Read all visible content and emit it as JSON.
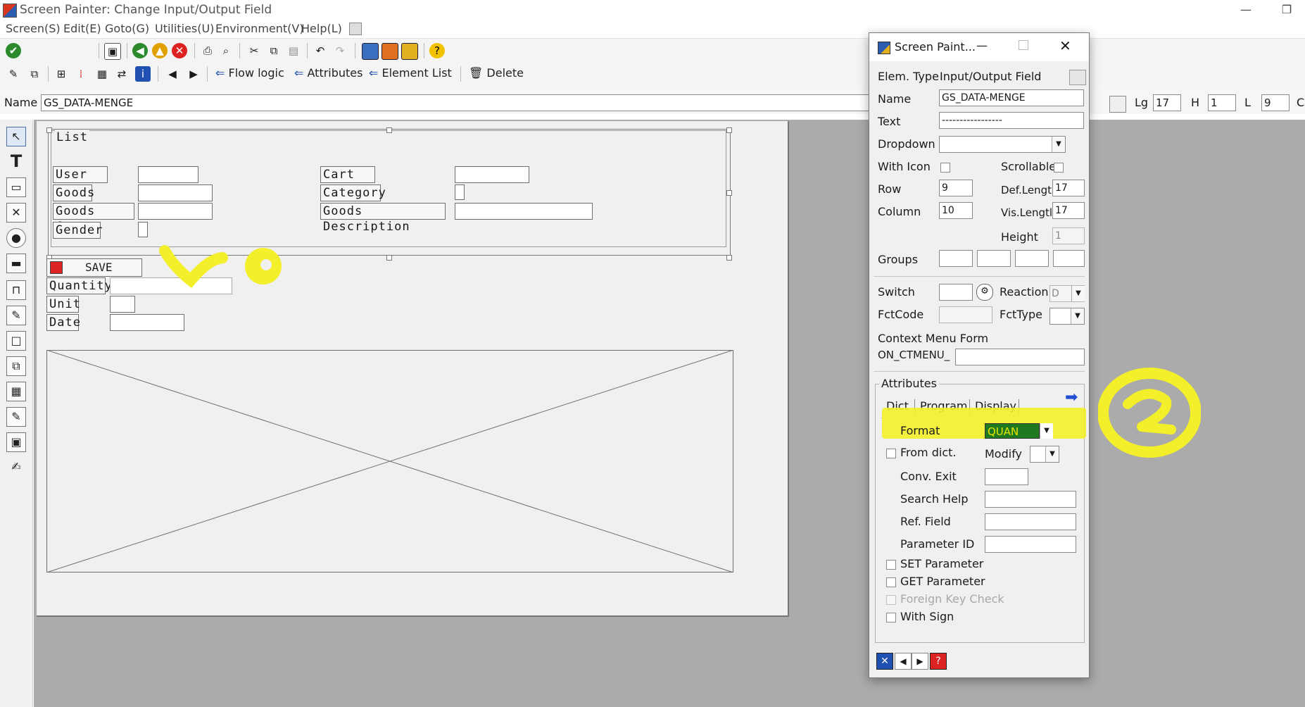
{
  "window": {
    "title": "Screen Painter:  Change Input/Output Field",
    "minimize": "—",
    "restore": "❐"
  },
  "menu": [
    "Screen(S)",
    "Edit(E)",
    "Goto(G)",
    "Utilities(U)",
    "Environment(V)",
    "Help(L)"
  ],
  "toolbar2": {
    "flow_logic": "Flow logic",
    "attributes": "Attributes",
    "element_list": "Element List",
    "delete": "Delete"
  },
  "namerow": {
    "label": "Name",
    "value": "GS_DATA-MENGE",
    "lg_label": "Lg",
    "lg_value": "17",
    "h_label": "H",
    "h_value": "1",
    "l_label": "L",
    "l_value": "9",
    "c_label": "C"
  },
  "screen": {
    "frame_title": "List",
    "labels_left": [
      "User ID",
      "Goods",
      "Goods Count",
      "Gender"
    ],
    "labels_right": [
      "Cart NO",
      "Category",
      "Goods Description"
    ],
    "save_button": "SAVE",
    "labels_bottom": [
      "Quantity",
      "Unit",
      "Date"
    ]
  },
  "popup": {
    "title": "Screen Paint...",
    "elem_type_label": "Elem. Type",
    "elem_type_value": "Input/Output Field",
    "name_label": "Name",
    "name_value": "GS_DATA-MENGE",
    "text_label": "Text",
    "text_value": "-----------------",
    "dropdown_label": "Dropdown",
    "with_icon_label": "With Icon",
    "scrollable_label": "Scrollable",
    "row_label": "Row",
    "row_value": "9",
    "column_label": "Column",
    "column_value": "10",
    "def_length_label": "Def.Lengtl",
    "def_length_value": "17",
    "vis_length_label": "Vis.Lengtl",
    "vis_length_value": "17",
    "height_label": "Height",
    "height_value": "1",
    "groups_label": "Groups",
    "switch_label": "Switch",
    "reaction_label": "Reaction",
    "reaction_value": "D",
    "fctcode_label": "FctCode",
    "fcttype_label": "FctType",
    "context_menu_label": "Context Menu Form",
    "context_menu_prefix": "ON_CTMENU_",
    "attributes_group": "Attributes",
    "tabs": [
      "Dict",
      "Program",
      "Display"
    ],
    "format_label": "Format",
    "format_value": "QUAN",
    "from_dict_label": "From dict.",
    "modify_label": "Modify",
    "conv_exit_label": "Conv. Exit",
    "search_help_label": "Search Help",
    "ref_field_label": "Ref. Field",
    "parameter_id_label": "Parameter ID",
    "set_param_label": "SET Parameter",
    "get_param_label": "GET Parameter",
    "foreign_key_label": "Foreign Key Check",
    "with_sign_label": "With Sign"
  },
  "colors": {
    "highlight": "#f3ef2a",
    "format_selected_bg": "#1f7a1f",
    "format_selected_text": "#e6e600"
  }
}
